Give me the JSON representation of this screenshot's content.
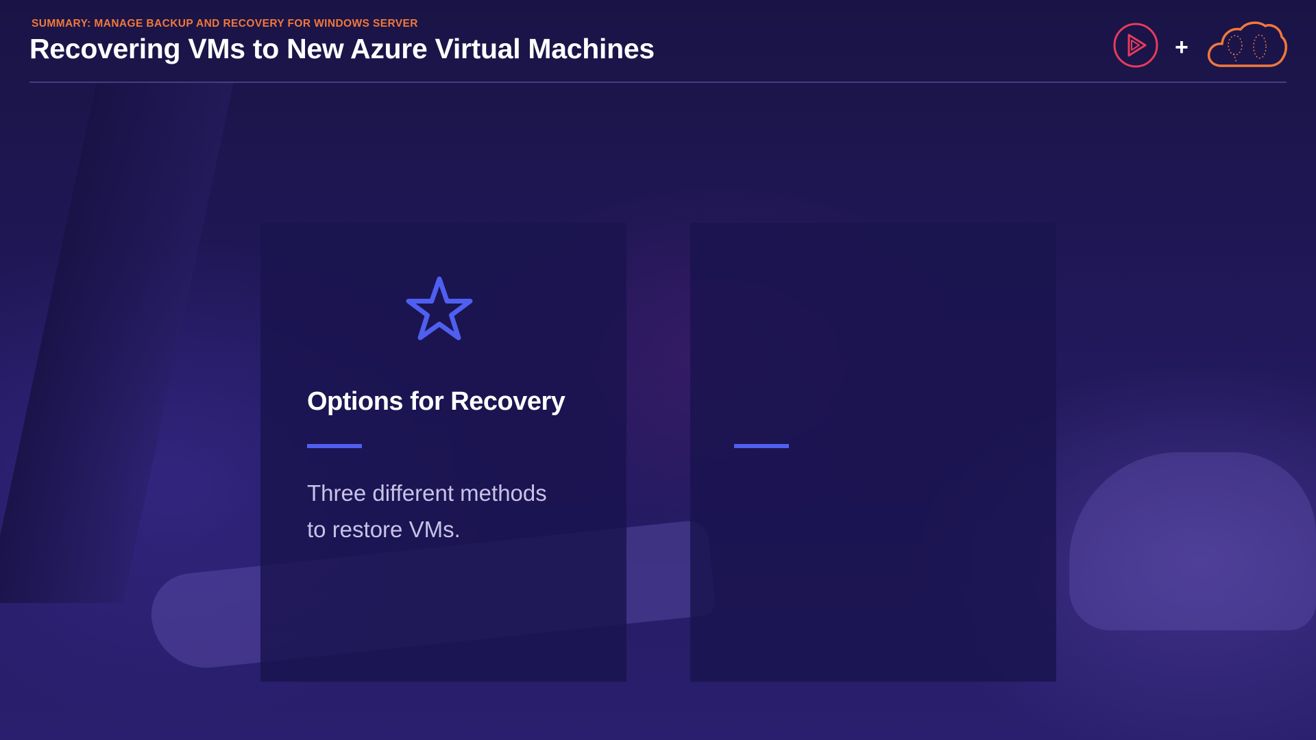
{
  "header": {
    "subtitle": "SUMMARY: MANAGE BACKUP AND RECOVERY FOR WINDOWS SERVER",
    "title": "Recovering VMs to New Azure Virtual Machines",
    "plus": "+"
  },
  "logos": {
    "left": "play-logo-icon",
    "right": "cloud-logo-icon"
  },
  "cards": [
    {
      "icon": "star-icon",
      "title": "Options for Recovery",
      "body_line1": "Three different methods",
      "body_line2": "to restore VMs."
    },
    {
      "title": "",
      "body_line1": "",
      "body_line2": ""
    }
  ],
  "colors": {
    "accent": "#4f5ff0",
    "subtitle": "#f2783b",
    "play_logo": "#e63c5c",
    "cloud_logo": "#f2783b",
    "background": "#1c1550"
  }
}
